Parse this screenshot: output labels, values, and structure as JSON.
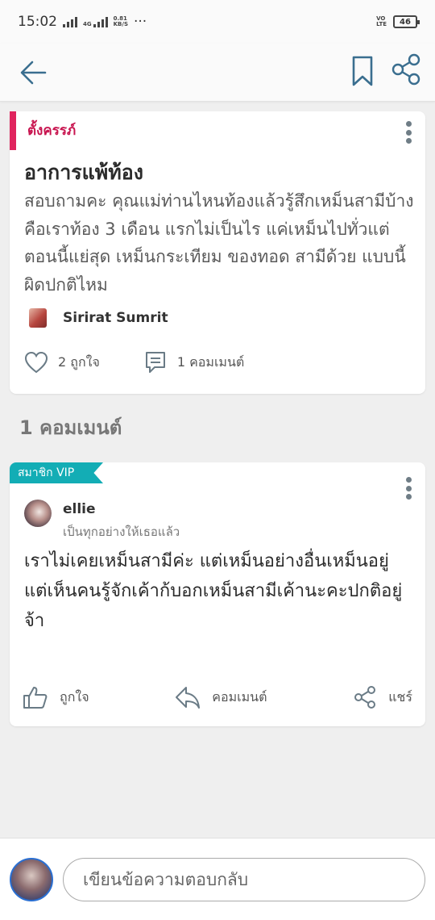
{
  "status_bar": {
    "time": "15:02",
    "net_type": "4G",
    "speed_value": "0.81",
    "speed_unit": "KB/S",
    "more": "···",
    "volte_top": "VO",
    "volte_bottom": "LTE",
    "battery": "46"
  },
  "app_bar": {
    "back_icon": "arrow-left-icon",
    "bookmark_icon": "bookmark-icon",
    "share_icon": "share-icon"
  },
  "post": {
    "category": "ตั้งครรภ์",
    "title": "อาการแพ้ท้อง",
    "body": "สอบถามคะ คุณแม่ท่านไหนท้องแล้วรู้สึกเหม็นสามีบ้าง  คือเราท้อง 3 เดือน แรกไม่เป็นไร แค่เหม็นไปทั่วแต่ตอนนี้แย่สุด เหม็นกระเทียม ของทอด สามีด้วย แบบนี้ผิดปกติไหม",
    "author": "Sirirat Sumrit",
    "likes": "2 ถูกใจ",
    "comments": "1 คอมเมนต์"
  },
  "comments_header": "1 คอมเมนต์",
  "comment": {
    "badge": "สมาชิก VIP",
    "name": "ellie",
    "subtitle": "เป็นทุกอย่างให้เธอแล้ว",
    "line1": "เราไม่เคยเหม็นสามีค่ะ แต่เหม็นอย่างอื่นเหม็นอยู่",
    "line2": "แต่เห็นคนรู้จักเค้าก้บอกเหม็นสามีเค้านะคะปกติอยู่จ้า",
    "like_label": "ถูกใจ",
    "comment_label": "คอมเมนต์",
    "share_label": "แชร์"
  },
  "reply": {
    "placeholder": "เขียนข้อความตอบกลับ"
  },
  "colors": {
    "accent_pink": "#e0245e",
    "vip_teal": "#13adb5",
    "avatar_ring": "#2a6fd1"
  }
}
